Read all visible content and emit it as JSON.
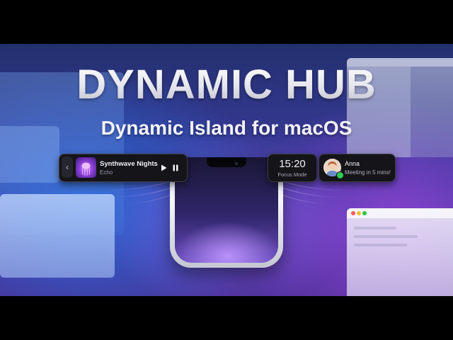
{
  "hero": {
    "title": "DYNAMIC HUB",
    "subtitle": "Dynamic Island for macOS"
  },
  "media_widget": {
    "back_icon": "chevron-left-icon",
    "track_title": "Synthwave Nights",
    "artist": "Echo",
    "controls": [
      "play-icon",
      "pause-icon"
    ]
  },
  "focus_widget": {
    "time": "15:20",
    "mode": "Focus Mode"
  },
  "notification_widget": {
    "sender": "Anna",
    "message": "Meeting in 5 mins!",
    "status_color": "#2ecc51"
  },
  "colors": {
    "accent_purple": "#7a4fd8",
    "pill_background": "#141419",
    "text_light": "#f4f4f8"
  }
}
